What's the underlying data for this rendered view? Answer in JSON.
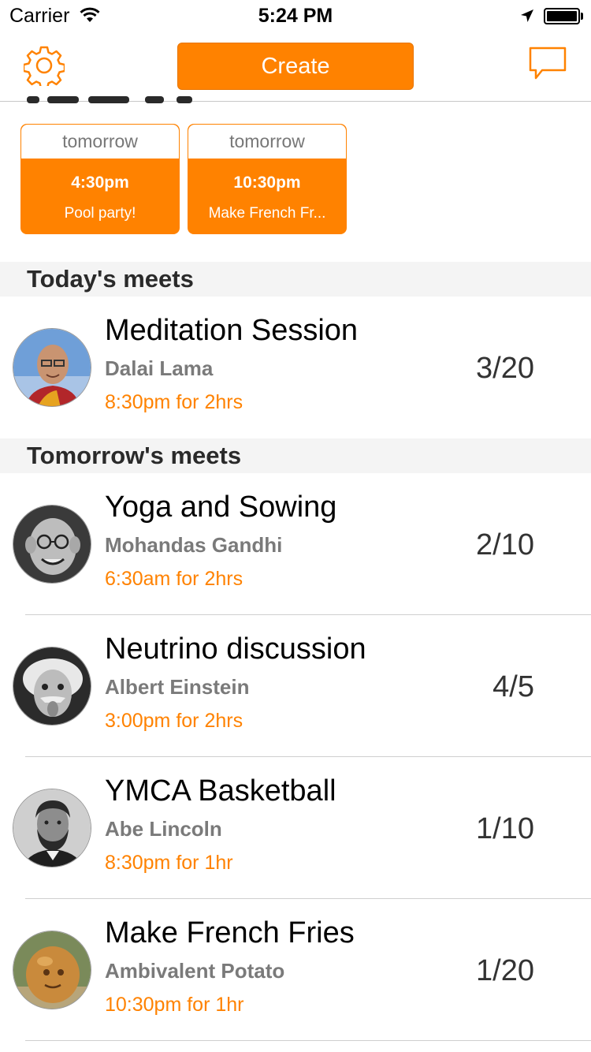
{
  "status_bar": {
    "carrier": "Carrier",
    "time": "5:24 PM"
  },
  "nav": {
    "create_label": "Create"
  },
  "colors": {
    "accent": "#ff8200",
    "host_gray": "#7a7a7a",
    "section_bg": "#f4f4f4"
  },
  "cards": [
    {
      "day": "tomorrow",
      "time": "4:30pm",
      "title": "Pool party!"
    },
    {
      "day": "tomorrow",
      "time": "10:30pm",
      "title": "Make French Fr..."
    }
  ],
  "sections": {
    "today": "Today's meets",
    "tomorrow": "Tomorrow's meets"
  },
  "meets": {
    "today": [
      {
        "title": "Meditation Session",
        "host": "Dalai Lama",
        "time": "8:30pm  for 2hrs",
        "count": "3/20",
        "avatar_icon": "dalai-lama-avatar"
      }
    ],
    "tomorrow": [
      {
        "title": "Yoga and Sowing",
        "host": "Mohandas Gandhi",
        "time": "6:30am  for 2hrs",
        "count": "2/10",
        "avatar_icon": "gandhi-avatar"
      },
      {
        "title": "Neutrino discussion",
        "host": "Albert Einstein",
        "time": "3:00pm  for 2hrs",
        "count": "4/5",
        "avatar_icon": "einstein-avatar"
      },
      {
        "title": "YMCA Basketball",
        "host": "Abe Lincoln",
        "time": "8:30pm  for 1hr",
        "count": "1/10",
        "avatar_icon": "lincoln-avatar"
      },
      {
        "title": "Make French Fries",
        "host": "Ambivalent Potato",
        "time": "10:30pm  for 1hr",
        "count": "1/20",
        "avatar_icon": "potato-avatar"
      }
    ]
  }
}
